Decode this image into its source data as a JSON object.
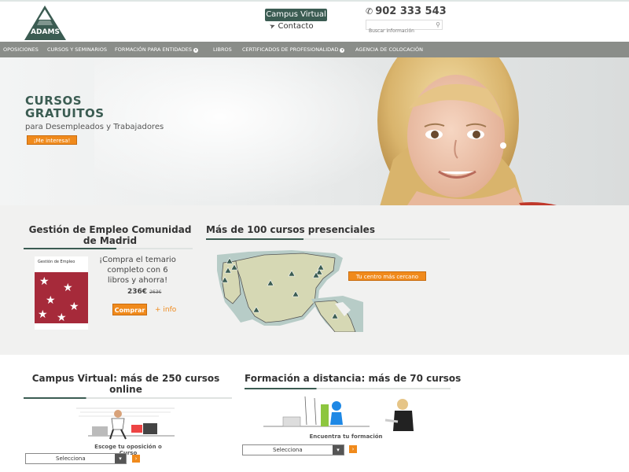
{
  "brand": {
    "logo_text": "ADAMS"
  },
  "header": {
    "campus_label": "Campus Virtual",
    "contacto_label": "Contacto",
    "phone": "902 333 543",
    "search_placeholder": "Buscar información"
  },
  "nav": {
    "items": [
      {
        "label": "Oposiciones",
        "has_dropdown": false
      },
      {
        "label": "Cursos y Seminarios",
        "has_dropdown": false
      },
      {
        "label": "Formación para entidades",
        "has_dropdown": true
      },
      {
        "label": "Libros",
        "has_dropdown": false
      },
      {
        "label": "Certificados de profesionalidad",
        "has_dropdown": true
      },
      {
        "label": "Agencia de colocación",
        "has_dropdown": false
      }
    ]
  },
  "hero": {
    "title_line1": "CURSOS",
    "title_line2": "GRATUITOS",
    "subtitle": "para Desempleados y Trabajadores",
    "cta": "¡Me interesa!"
  },
  "empleo": {
    "heading": "Gestión de Empleo Comunidad de Madrid",
    "book_title": "Gestión de Empleo",
    "promo_line1": "¡Compra el temario",
    "promo_line2": "completo con 6",
    "promo_line3": "libros y ahorra!",
    "price": "236€",
    "old_price": "263€",
    "buy_label": "Comprar",
    "info_label": "+ info"
  },
  "presenciales": {
    "heading": "Más de 100 cursos presenciales",
    "cta": "Tu centro más cercano"
  },
  "campus": {
    "heading": "Campus Virtual: más de 250 cursos online",
    "caption": "Escoge tu oposición o Curso",
    "select_value": "Selecciona"
  },
  "distancia": {
    "heading": "Formación a distancia: más de 70 cursos",
    "caption": "Encuentra tu formación",
    "select_value": "Selecciona"
  },
  "colors": {
    "accent_green": "#3b5c52",
    "accent_orange": "#f08a1c",
    "nav_grey": "#8a8d89"
  }
}
